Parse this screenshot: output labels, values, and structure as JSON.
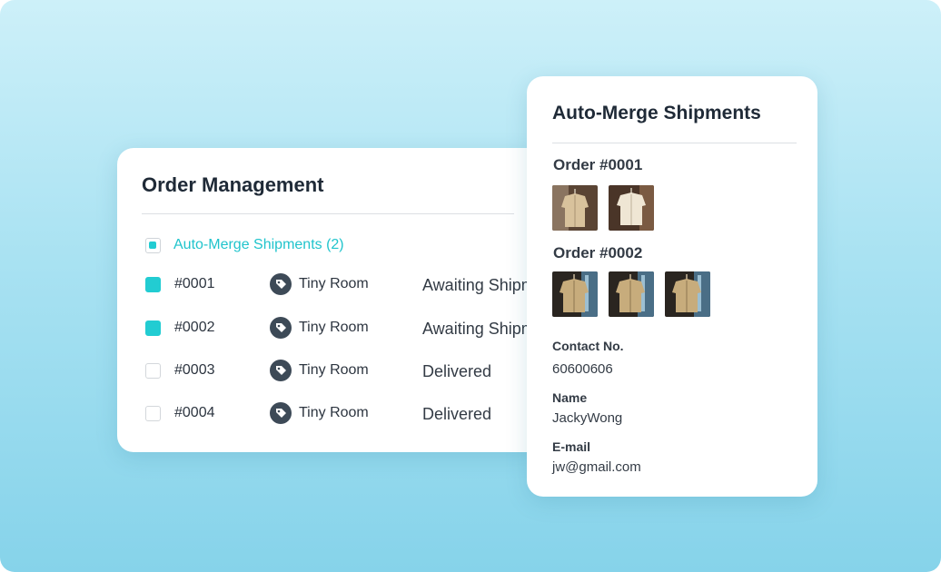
{
  "order_management": {
    "title": "Order Management",
    "group_label": "Auto-Merge Shipments (2)",
    "rows": [
      {
        "id": "#0001",
        "store": "Tiny Room",
        "status": "Awaiting Shipment",
        "checked": true
      },
      {
        "id": "#0002",
        "store": "Tiny Room",
        "status": "Awaiting Shipment",
        "checked": true
      },
      {
        "id": "#0003",
        "store": "Tiny Room",
        "status": "Delivered",
        "checked": false
      },
      {
        "id": "#0004",
        "store": "Tiny Room",
        "status": "Delivered",
        "checked": false
      }
    ]
  },
  "auto_merge": {
    "title": "Auto-Merge Shipments",
    "orders": [
      {
        "label": "Order #0001",
        "thumbnail_count": 2
      },
      {
        "label": "Order #0002",
        "thumbnail_count": 3
      }
    ],
    "contact_label": "Contact No.",
    "contact_value": "60600606",
    "name_label": "Name",
    "name_value": "JackyWong",
    "email_label": "E-mail",
    "email_value": "jw@gmail.com"
  },
  "colors": {
    "accent": "#22ccd2",
    "text_dark": "#1f2a37",
    "background_top": "#cdf0f9",
    "background_bottom": "#86d3ea"
  },
  "icons": {
    "store": "price-tag-icon",
    "product": "shirt-photo"
  }
}
